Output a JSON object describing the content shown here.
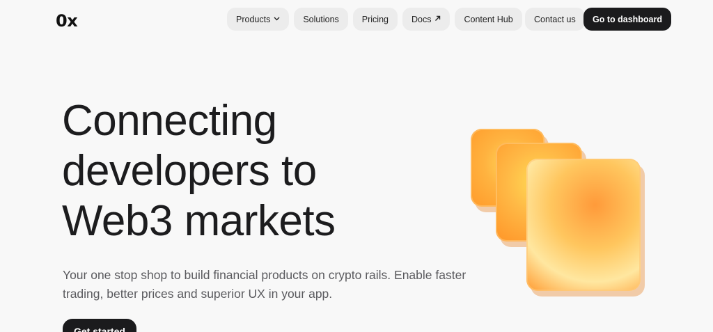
{
  "brand": {
    "logo_text": "0x"
  },
  "nav": {
    "products": "Products",
    "solutions": "Solutions",
    "pricing": "Pricing",
    "docs": "Docs",
    "content_hub": "Content Hub"
  },
  "header": {
    "contact": "Contact us",
    "dashboard": "Go to dashboard"
  },
  "hero": {
    "headline_line1": "Connecting",
    "headline_line2": "developers to",
    "headline_line3": "Web3 markets",
    "subtitle": "Your one stop shop to build financial products on crypto rails. Enable faster trading, better prices and superior UX in your app.",
    "cta": "Get started"
  },
  "icons": {
    "products_chevron": "chevron-down-icon",
    "docs_external": "arrow-up-right-icon"
  },
  "colors": {
    "background": "#f8f8f8",
    "pill": "#ececec",
    "dark": "#1b1b1d",
    "accent_orange": "#ff9a2a"
  }
}
